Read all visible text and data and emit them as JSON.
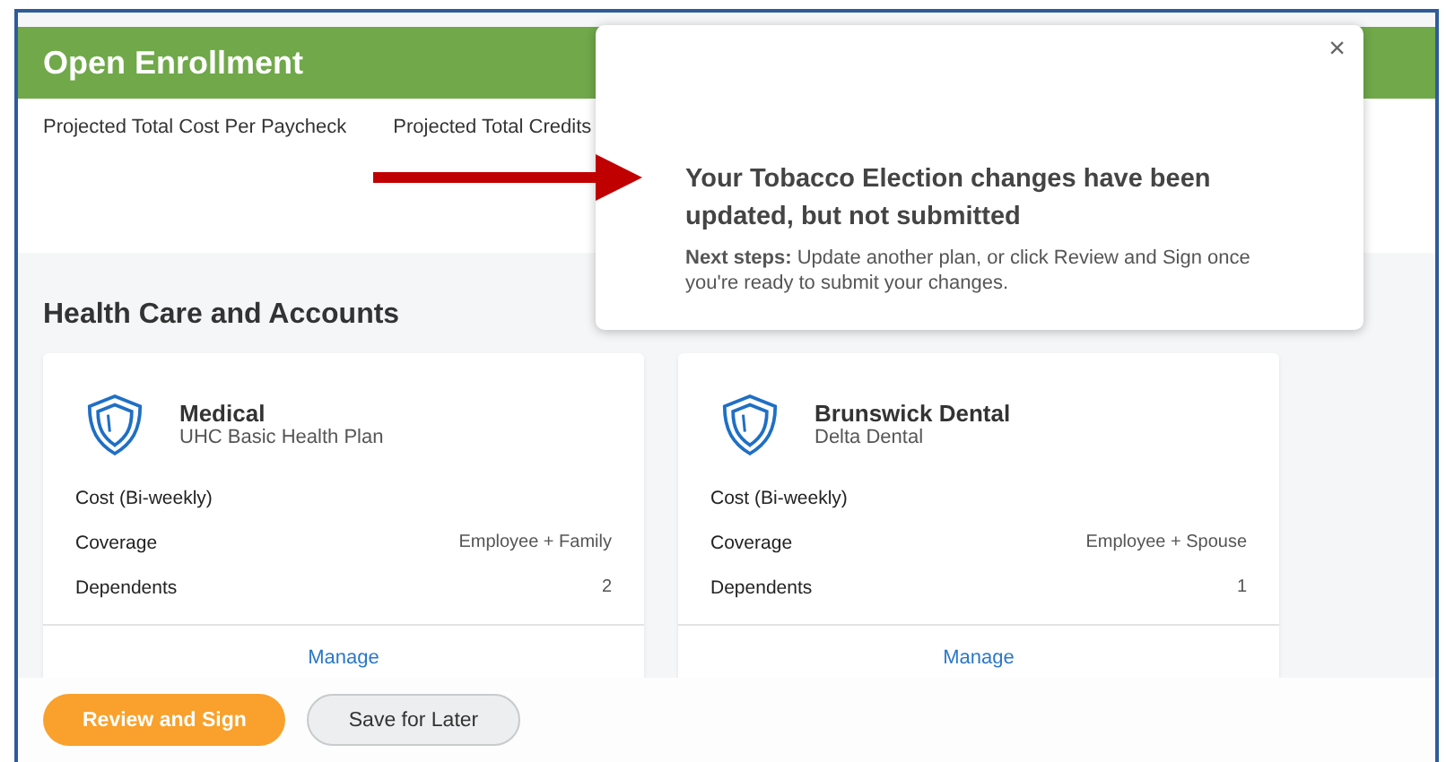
{
  "header": {
    "title": "Open Enrollment"
  },
  "summary": [
    "Projected Total Cost Per Paycheck",
    "Projected Total Credits"
  ],
  "section": {
    "title": "Health Care and Accounts"
  },
  "cards": [
    {
      "title": "Medical",
      "subtitle": "UHC Basic Health Plan",
      "rows": [
        {
          "label": "Cost (Bi-weekly)"
        },
        {
          "label": "Coverage",
          "value": "Employee + Family"
        },
        {
          "label": "Dependents",
          "value": "2"
        }
      ],
      "link": "Manage"
    },
    {
      "title": "Brunswick Dental",
      "subtitle": "Delta Dental",
      "rows": [
        {
          "label": "Cost (Bi-weekly)"
        },
        {
          "label": "Coverage",
          "value": "Employee + Spouse"
        },
        {
          "label": "Dependents",
          "value": "1"
        }
      ],
      "link": "Manage"
    }
  ],
  "footer": {
    "buttons": [
      {
        "label": "Review and Sign",
        "kind": "primary"
      },
      {
        "label": "Save for Later",
        "kind": "secondary"
      }
    ]
  },
  "popup": {
    "close": "×",
    "title": "Your Tobacco Election changes have been updated, but not submitted",
    "body": "**Next steps:**  Update another plan, or click Review and Sign once you're ready to submit your changes."
  }
}
